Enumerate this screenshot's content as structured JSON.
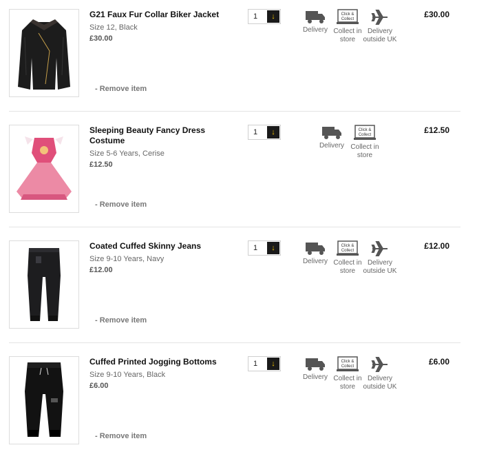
{
  "basket": {
    "items": [
      {
        "name": "G21 Faux Fur Collar Biker Jacket",
        "details": "Size 12, Black",
        "price": "£30.00",
        "remove_label": "- Remove item",
        "quantity": "1",
        "delivery_label": "Delivery",
        "collect_label": "Collect in store",
        "outside_label": "Delivery outside UK",
        "total": "£30.00"
      },
      {
        "name": "Sleeping Beauty Fancy Dress Costume",
        "details": "Size 5-6 Years, Cerise",
        "price": "£12.50",
        "remove_label": "- Remove item",
        "quantity": "1",
        "delivery_label": "Delivery",
        "collect_label": "Collect in store",
        "total": "£12.50"
      },
      {
        "name": "Coated Cuffed Skinny Jeans",
        "details": "Size 9-10 Years, Navy",
        "price": "£12.00",
        "remove_label": "- Remove item",
        "quantity": "1",
        "delivery_label": "Delivery",
        "collect_label": "Collect in store",
        "outside_label": "Delivery outside UK",
        "total": "£12.00"
      },
      {
        "name": "Cuffed Printed Jogging Bottoms",
        "details": "Size 9-10 Years, Black",
        "price": "£6.00",
        "remove_label": "- Remove item",
        "quantity": "1",
        "delivery_label": "Delivery",
        "collect_label": "Collect in store",
        "outside_label": "Delivery outside UK",
        "total": "£6.00"
      }
    ],
    "collect_badge_top": "Click &",
    "collect_badge_bottom": "Collect"
  },
  "icons": {
    "quantity_arrow": "arrow-down-icon",
    "delivery": "truck-icon",
    "collect": "click-collect-icon",
    "outside_uk": "plane-icon"
  },
  "colors": {
    "accent": "#f2c200",
    "dark": "#1a1a1a",
    "text": "#111111",
    "muted": "#666666",
    "icon": "#555555"
  }
}
